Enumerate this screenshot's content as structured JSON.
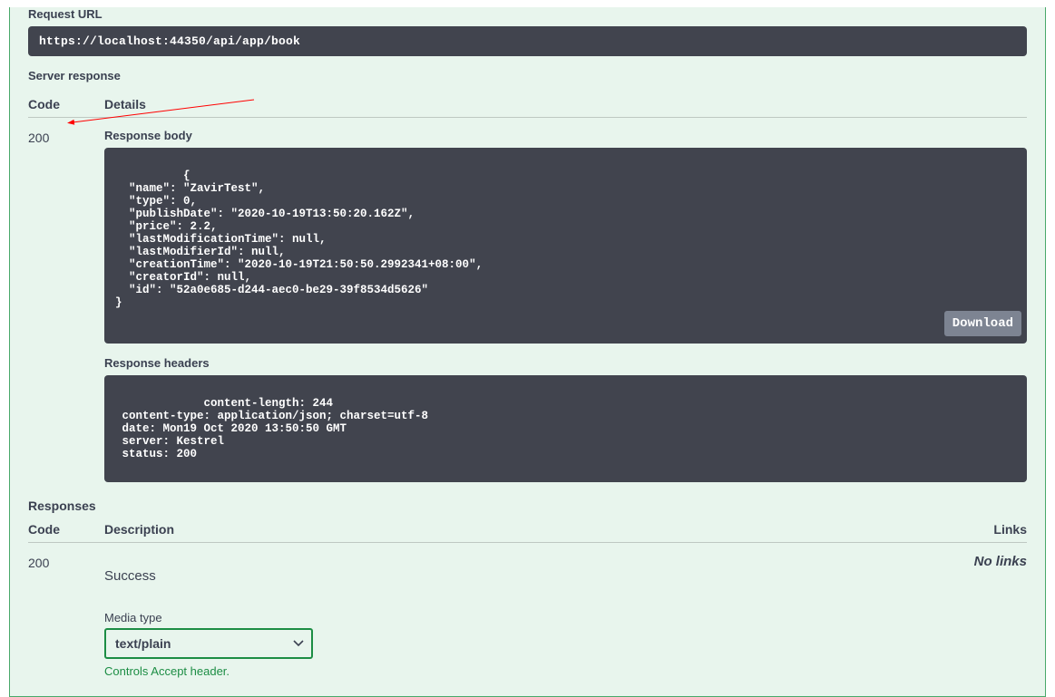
{
  "request_url_label": "Request URL",
  "request_url": "https://localhost:44350/api/app/book",
  "server_response_label": "Server response",
  "col_code": "Code",
  "col_details": "Details",
  "response_code": "200",
  "response_body_label": "Response body",
  "response_body": "{\n  \"name\": \"ZavirTest\",\n  \"type\": 0,\n  \"publishDate\": \"2020-10-19T13:50:20.162Z\",\n  \"price\": 2.2,\n  \"lastModificationTime\": null,\n  \"lastModifierId\": null,\n  \"creationTime\": \"2020-10-19T21:50:50.2992341+08:00\",\n  \"creatorId\": null,\n  \"id\": \"52a0e685-d244-aec0-be29-39f8534d5626\"\n}",
  "download_label": "Download",
  "response_headers_label": "Response headers",
  "response_headers": " content-length: 244\n content-type: application/json; charset=utf-8\n date: Mon19 Oct 2020 13:50:50 GMT\n server: Kestrel\n status: 200",
  "responses_label": "Responses",
  "col_description": "Description",
  "col_links": "Links",
  "responses_code": "200",
  "success_text": "Success",
  "no_links": "No links",
  "media_type_label": "Media type",
  "media_select_value": "text/plain",
  "accept_note": "Controls Accept header."
}
